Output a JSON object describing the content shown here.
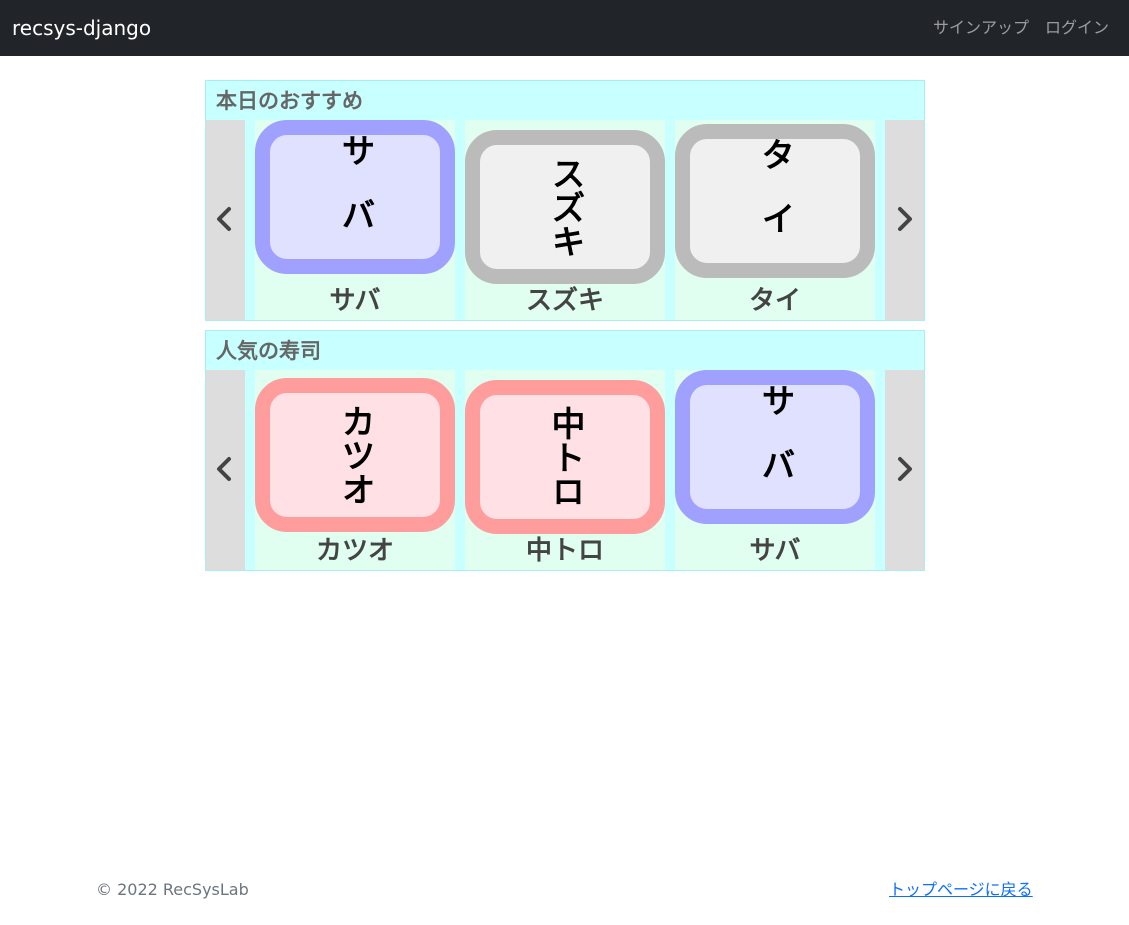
{
  "navbar": {
    "brand": "recsys-django",
    "signup_label": "サインアップ",
    "login_label": "ログイン"
  },
  "sections": [
    {
      "title": "本日のおすすめ",
      "items": [
        {
          "tile_text": "サバ",
          "label": "サバ",
          "color": "blue"
        },
        {
          "tile_text": "スズキ",
          "label": "スズキ",
          "color": "gray"
        },
        {
          "tile_text": "タイ",
          "label": "タイ",
          "color": "gray"
        }
      ]
    },
    {
      "title": "人気の寿司",
      "items": [
        {
          "tile_text": "カツオ",
          "label": "カツオ",
          "color": "red"
        },
        {
          "tile_text": "中トロ",
          "label": "中トロ",
          "color": "red"
        },
        {
          "tile_text": "サバ",
          "label": "サバ",
          "color": "blue"
        }
      ]
    }
  ],
  "icons": {
    "prev": "chevron-left-icon",
    "next": "chevron-right-icon"
  },
  "colors": {
    "navbar_bg": "#212529",
    "section_bg": "#c8ffff",
    "card_bg": "#e0fff0",
    "blue_border": "#a0a0ff",
    "blue_fill": "#e0e0ff",
    "gray_border": "#bbbbbb",
    "gray_fill": "#f0f0f0",
    "red_border": "#ff9d9d",
    "red_fill": "#ffe0e4",
    "link": "#0d6efd"
  },
  "footer": {
    "copyright": "© 2022 RecSysLab",
    "top_link": "トップページに戻る"
  }
}
